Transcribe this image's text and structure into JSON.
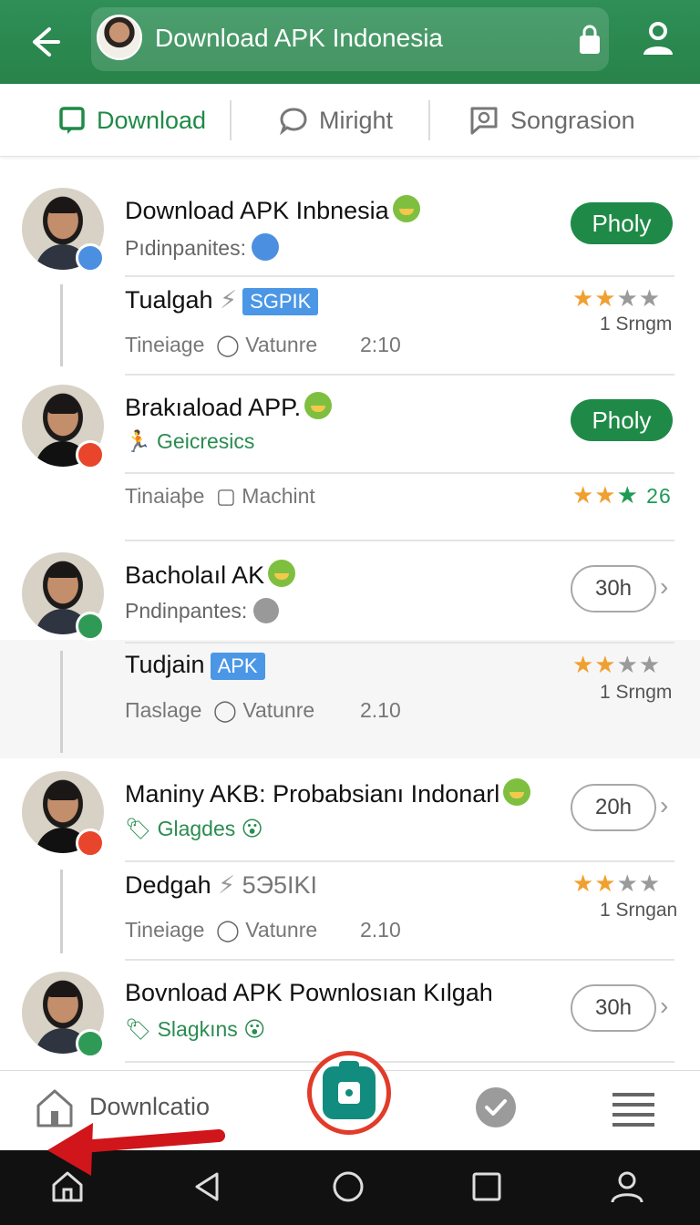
{
  "appbar": {
    "title": "Download APK Indonesia"
  },
  "tabs": [
    {
      "label": "Download",
      "icon": "chat-square-icon",
      "active": true
    },
    {
      "label": "Miright",
      "icon": "chat-bubble-icon",
      "active": false
    },
    {
      "label": "Songrasion",
      "icon": "message-square-icon",
      "active": false
    }
  ],
  "items": [
    {
      "title": "Download APK Inbnesia",
      "subtitle": "Pıdinpanites:",
      "action": "Pholy",
      "sub_title": "Tualgah",
      "tag": "SGPIK",
      "meta1": "Tineiage",
      "meta2": "Vatunre",
      "meta3": "2:10",
      "rating": "1 Srngm",
      "stars_on": 2
    },
    {
      "title": "Brakıaload APP.",
      "subtitle": "Geicresics",
      "action": "Pholy",
      "meta1": "Tinaiaþe",
      "meta2": "Machint",
      "rating": "26",
      "stars_on": 3
    },
    {
      "title": "Bacholaıl AK",
      "subtitle": "Pndinpantes:",
      "action": "30h",
      "sub_title": "Tudjain",
      "tag": "APK",
      "meta1": "Πaslage",
      "meta2": "Vatunre",
      "meta3": "2.10",
      "rating": "1 Srngm",
      "stars_on": 2
    },
    {
      "title": "Maniny AKB: Probabsianı Indonarl",
      "subtitle": "Glagdes",
      "action": "20h",
      "sub_title": "Dedgah",
      "tag": "5Э5IKI",
      "meta1": "Tineiage",
      "meta2": "Vatunre",
      "meta3": "2.10",
      "rating": "1 Srngan",
      "stars_on": 2
    },
    {
      "title": "Bovnload APK Pownlosıan Kılgah",
      "subtitle": "Slagkıns",
      "action": "30h"
    }
  ],
  "bottomnav": {
    "home_label": "Downlcatio"
  },
  "colors": {
    "primary": "#2f8f57",
    "accent_red": "#e23b2a",
    "tag_blue": "#4b97e6",
    "star": "#f0a030"
  }
}
